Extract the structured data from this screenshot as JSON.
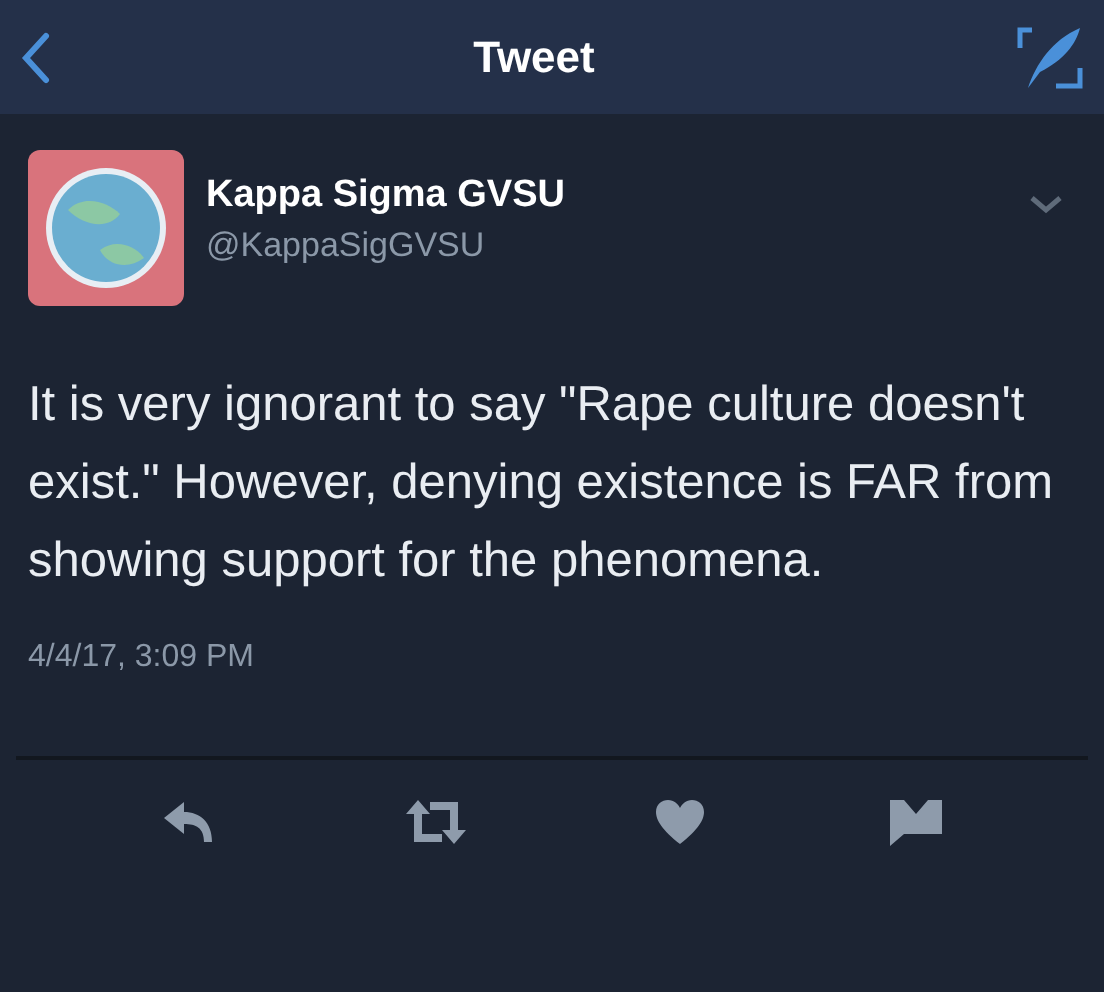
{
  "header": {
    "title": "Tweet"
  },
  "tweet": {
    "author": "Kappa Sigma GVSU",
    "handle": "@KappaSigGVSU",
    "text": "It is very ignorant to say \"Rape culture doesn't exist.\" However, denying existence is FAR from showing support for the phenomena.",
    "timestamp": "4/4/17, 3:09 PM"
  }
}
